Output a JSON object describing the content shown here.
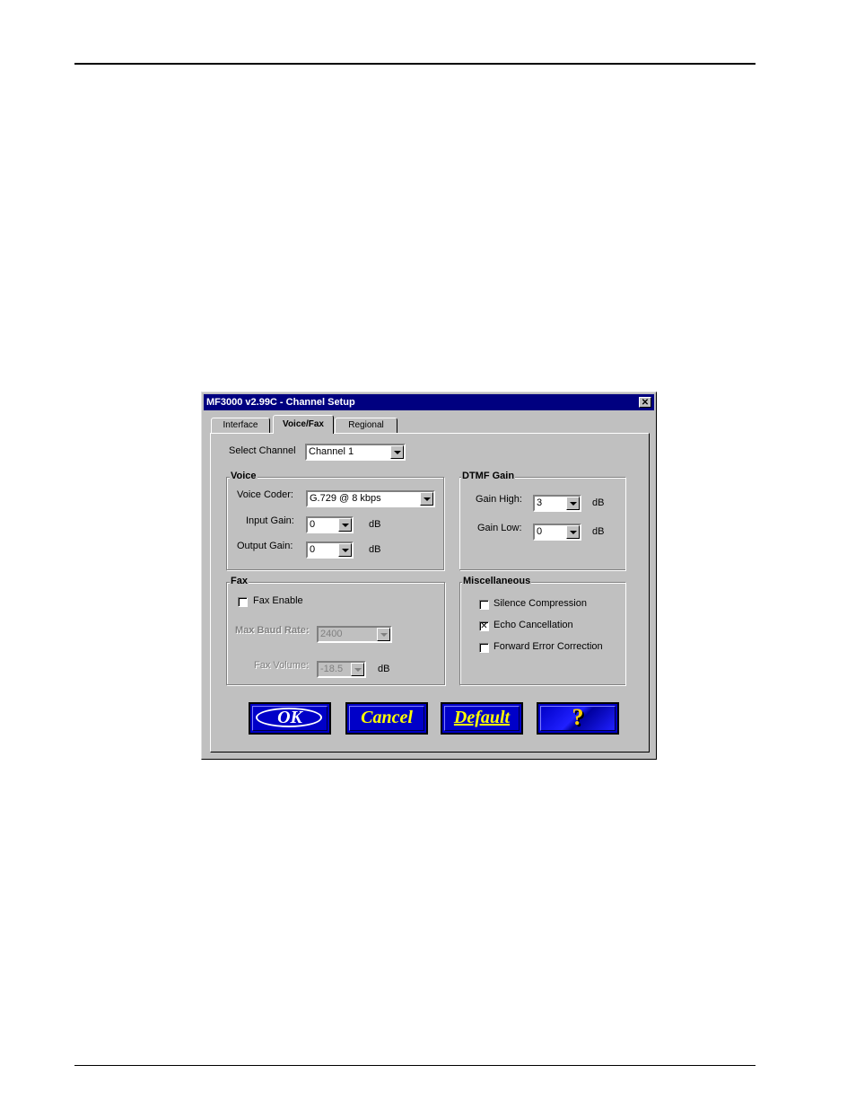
{
  "window": {
    "title": "MF3000 v2.99C - Channel Setup",
    "close_label": "✕"
  },
  "tabs": [
    {
      "label": "Interface",
      "active": false
    },
    {
      "label": "Voice/Fax",
      "active": true
    },
    {
      "label": "Regional",
      "active": false
    }
  ],
  "select_channel": {
    "label": "Select Channel",
    "value": "Channel 1"
  },
  "voice": {
    "title": "Voice",
    "coder_label": "Voice Coder:",
    "coder_value": "G.729 @ 8 kbps",
    "input_gain_label": "Input Gain:",
    "input_gain_value": "0",
    "input_gain_unit": "dB",
    "output_gain_label": "Output Gain:",
    "output_gain_value": "0",
    "output_gain_unit": "dB"
  },
  "dtmf": {
    "title": "DTMF Gain",
    "high_label": "Gain High:",
    "high_value": "3",
    "high_unit": "dB",
    "low_label": "Gain Low:",
    "low_value": "0",
    "low_unit": "dB"
  },
  "fax": {
    "title": "Fax",
    "enable_label": "Fax  Enable",
    "enable_checked": false,
    "baud_label": "Max Baud Rate:",
    "baud_value": "2400",
    "volume_label": "Fax Volume:",
    "volume_value": "-18.5",
    "volume_unit": "dB"
  },
  "misc": {
    "title": "Miscellaneous",
    "silence_label": "Silence Compression",
    "silence_checked": false,
    "echo_label": "Echo Cancellation",
    "echo_checked": true,
    "fec_label": "Forward Error Correction",
    "fec_checked": false,
    "check_mark": "✕"
  },
  "buttons": {
    "ok": "OK",
    "cancel": "Cancel",
    "default": "Default",
    "help": "?"
  }
}
